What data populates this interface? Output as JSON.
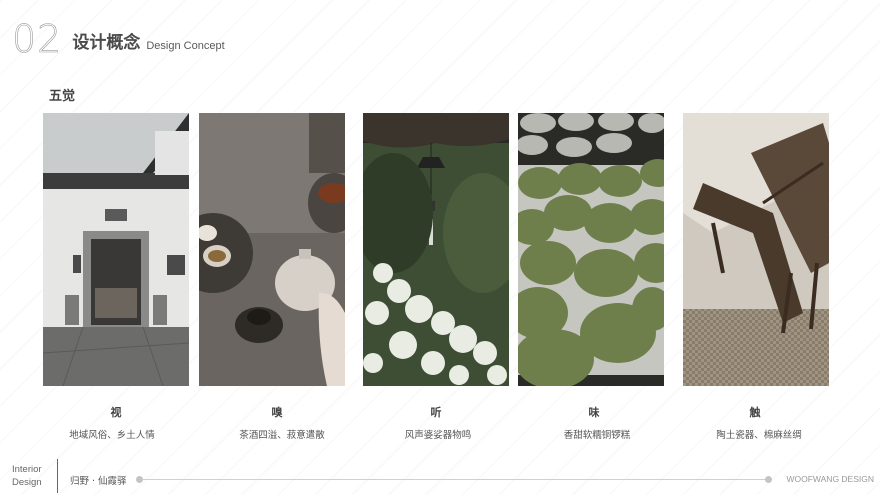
{
  "header": {
    "number": "02",
    "title_cn": "设计概念",
    "title_en": "Design Concept"
  },
  "section": {
    "title": "五觉"
  },
  "senses": [
    {
      "title": "视",
      "desc": "地域风俗、乡土人情",
      "image": "white-wall-courtyard-entrance-photo"
    },
    {
      "title": "嗅",
      "desc": "茶酒四溢、菽意遣散",
      "image": "tea-pouring-photo"
    },
    {
      "title": "听",
      "desc": "风声婆娑器物鸣",
      "image": "wind-chime-flowers-photo"
    },
    {
      "title": "味",
      "desc": "香甜软糯铜锣糕",
      "image": "green-rice-cakes-photo"
    },
    {
      "title": "触",
      "desc": "陶土瓷器、棉麻丝绸",
      "image": "wooden-chair-photo"
    }
  ],
  "footer": {
    "left_line1": "Interior",
    "left_line2": "Design",
    "project": "归野 · 仙霞驿",
    "brand": "WOOFWANG DESIGN"
  }
}
